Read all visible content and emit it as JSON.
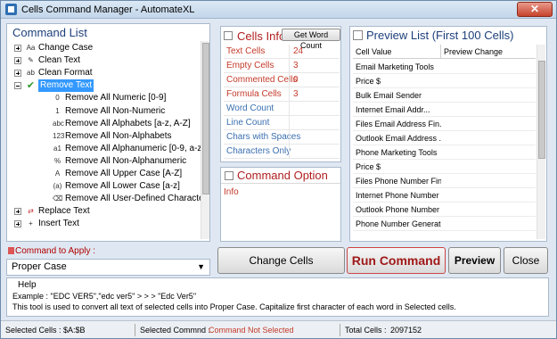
{
  "window": {
    "title": "Cells Command Manager - AutomateXL",
    "close_glyph": "✕"
  },
  "command_list": {
    "header": "Command List",
    "items": [
      {
        "label": "Change Case",
        "level": 0,
        "expander": "plus",
        "icon": "case-icon",
        "glyph": "Aa"
      },
      {
        "label": "Clean Text",
        "level": 0,
        "expander": "plus",
        "icon": "clean-text-icon",
        "glyph": "✎"
      },
      {
        "label": "Clean Format",
        "level": 0,
        "expander": "plus",
        "icon": "clean-format-icon",
        "glyph": "ab"
      },
      {
        "label": "Remove Text",
        "level": 0,
        "expander": "minus",
        "icon": "checkmark-icon",
        "glyph": "✔",
        "selected": true
      },
      {
        "label": "Remove All Numeric [0-9]",
        "level": 1,
        "icon": "numeric-icon",
        "glyph": "0"
      },
      {
        "label": "Remove All Non-Numeric",
        "level": 1,
        "icon": "non-numeric-icon",
        "glyph": "1"
      },
      {
        "label": "Remove All Alphabets [a-z, A-Z]",
        "level": 1,
        "icon": "alphabets-icon",
        "glyph": "abc"
      },
      {
        "label": "Remove All Non-Alphabets",
        "level": 1,
        "icon": "non-alphabets-icon",
        "glyph": "123"
      },
      {
        "label": "Remove All Alphanumeric [0-9, a-z, A-Z]",
        "level": 1,
        "icon": "alphanumeric-icon",
        "glyph": "a1"
      },
      {
        "label": "Remove All Non-Alphanumeric",
        "level": 1,
        "icon": "non-alphanumeric-icon",
        "glyph": "%"
      },
      {
        "label": "Remove All Upper Case [A-Z]",
        "level": 1,
        "icon": "upper-case-icon",
        "glyph": "A"
      },
      {
        "label": "Remove All Lower Case [a-z]",
        "level": 1,
        "icon": "lower-case-icon",
        "glyph": "(a)"
      },
      {
        "label": "Remove All User-Defined Characters",
        "level": 1,
        "icon": "user-defined-icon",
        "glyph": "⌫"
      },
      {
        "label": "Replace Text",
        "level": 0,
        "expander": "plus",
        "icon": "replace-icon",
        "glyph": "⇄"
      },
      {
        "label": "Insert Text",
        "level": 0,
        "expander": "plus",
        "icon": "insert-icon",
        "glyph": "+"
      }
    ]
  },
  "apply": {
    "label": "Command to Apply :",
    "value": "Proper Case"
  },
  "cells_info": {
    "header": "Cells Info",
    "word_count_button": "Get Word Count",
    "rows": [
      {
        "label": "Text Cells",
        "value": "24",
        "accent": true
      },
      {
        "label": "Empty Cells",
        "value": "3",
        "accent": true
      },
      {
        "label": "Commented Cells",
        "value": "0",
        "accent": true
      },
      {
        "label": "Formula Cells",
        "value": "3",
        "accent": true
      },
      {
        "label": "Word Count",
        "value": "",
        "accent": false
      },
      {
        "label": "Line Count",
        "value": "",
        "accent": false
      },
      {
        "label": "Chars with Spaces",
        "value": "",
        "accent": false
      },
      {
        "label": "Characters Only",
        "value": "",
        "accent": false
      }
    ]
  },
  "command_option": {
    "header": "Command Option",
    "info": "Info"
  },
  "preview": {
    "header": "Preview List (First 100 Cells)",
    "col_value": "Cell Value",
    "col_change": "Preview Change",
    "rows": [
      "Email Marketing Tools",
      "Price $",
      "Bulk    Email    Sender",
      "Internet    Email    Addr...",
      "Files Email Address    Fin...",
      "Outlook Email Address ...",
      "Phone Marketing Tools",
      "Price $",
      "Files Phone Number Fin...",
      "Internet Phone Number ...",
      "Outlook Phone Number ...",
      "Phone Number Generator"
    ]
  },
  "buttons": {
    "change_cells": "Change Cells",
    "run_command": "Run Command",
    "preview": "Preview",
    "close": "Close"
  },
  "help": {
    "title": "Help",
    "example": "Example : \"EDC VER5\",\"edc ver5\" > > >  \"Edc Ver5\"",
    "description": "This tool is used to convert all text of selected cells into Proper Case. Capitalize first character of each word in Selected cells."
  },
  "status": {
    "selected_cells_label": "Selected Cells :",
    "selected_cells_value": "$A:$B",
    "selected_command_label": "Selected Commnd :",
    "selected_command_value": "Command Not Selected",
    "total_cells_label": "Total Cells :",
    "total_cells_value": "2097152"
  },
  "colors": {
    "accent_red": "#c43a2a",
    "header_blue": "#1c3f7a",
    "selection_blue": "#3399ff"
  }
}
